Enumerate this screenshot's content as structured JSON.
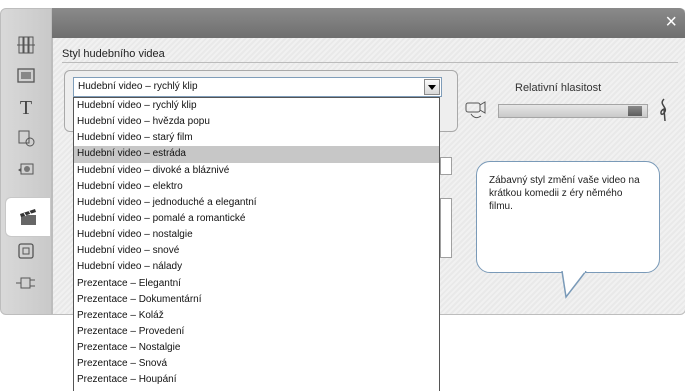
{
  "dialog": {
    "section_label": "Styl hudebního videa",
    "close_glyph": "×"
  },
  "style_select": {
    "value": "Hudební video – rychlý klip",
    "options": [
      "Hudební video – rychlý klip",
      "Hudební video – hvězda popu",
      "Hudební video – starý film",
      "Hudební video – estráda",
      "Hudební video – divoké a bláznivé",
      "Hudební video – elektro",
      "Hudební video – jednoduché a elegantní",
      "Hudební video – pomalé a romantické",
      "Hudební video – nostalgie",
      "Hudební video – snové",
      "Hudební video – nálady",
      "Prezentace – Elegantní",
      "Prezentace – Dokumentární",
      "Prezentace – Koláž",
      "Prezentace – Provedení",
      "Prezentace – Nostalgie",
      "Prezentace – Snová",
      "Prezentace – Houpání"
    ],
    "highlighted_index": 3
  },
  "volume": {
    "label": "Relativní hlasitost",
    "level": 0.9
  },
  "tooltip": {
    "text": "Zábavný styl změní vaše video na krátkou komedii z éry němého filmu."
  },
  "sidebar": {
    "items": [
      "tracks-icon",
      "screen-icon",
      "title-icon",
      "disc-icon",
      "camera-icon",
      "clapper-icon",
      "frame-icon",
      "plug-icon"
    ],
    "active_index": 5
  },
  "colors": {
    "titlebar": "#7a7a7a",
    "selection": "#c7c7c7",
    "bubble_border": "#7a9ab8"
  }
}
